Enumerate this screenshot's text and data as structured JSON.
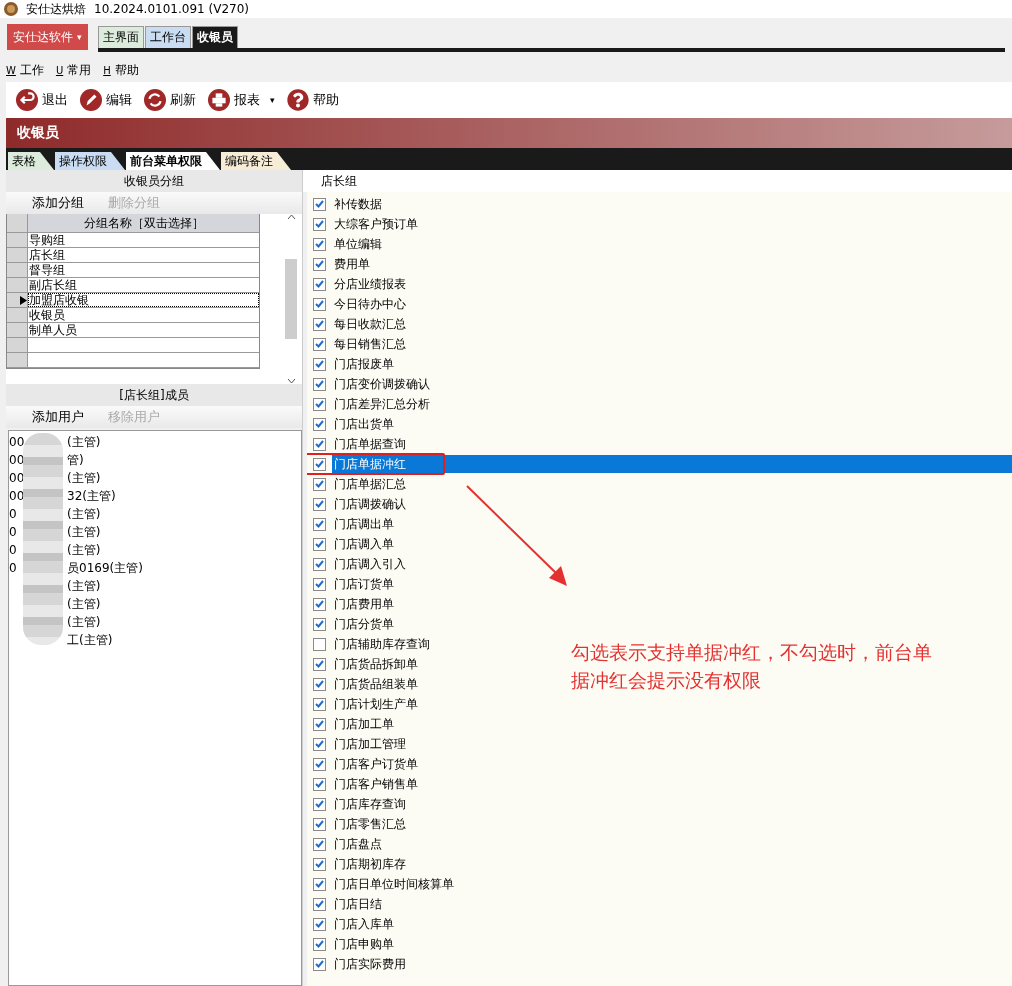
{
  "window": {
    "title": "安仕达烘焙",
    "version": "10.2024.0101.091 (V270)"
  },
  "brand_menu": {
    "label": "安仕达软件",
    "caret": "▾"
  },
  "app_tabs": [
    {
      "label": "主界面",
      "selected": false
    },
    {
      "label": "工作台",
      "selected": false
    },
    {
      "label": "收银员",
      "selected": true
    }
  ],
  "menu": [
    {
      "key": "W",
      "label": "工作"
    },
    {
      "key": "U",
      "label": "常用"
    },
    {
      "key": "H",
      "label": "帮助"
    }
  ],
  "toolbar": [
    {
      "kind": "exit",
      "label": "退出"
    },
    {
      "kind": "edit",
      "label": "编辑"
    },
    {
      "kind": "refresh",
      "label": "刷新"
    },
    {
      "kind": "print",
      "label": "报表",
      "caret": "▾"
    },
    {
      "kind": "help",
      "label": "帮助"
    }
  ],
  "page_title": "收银员",
  "page_tabs": [
    {
      "label": "表格",
      "selected": false,
      "color": "#dcebdc"
    },
    {
      "label": "操作权限",
      "selected": false,
      "color": "#c9dcf2"
    },
    {
      "label": "前台菜单权限",
      "selected": true,
      "color": "#ffffff"
    },
    {
      "label": "编码备注",
      "selected": false,
      "color": "#f7ecd6"
    }
  ],
  "groups_panel": {
    "title": "收银员分组",
    "actions": [
      {
        "label": "添加分组",
        "disabled": false
      },
      {
        "label": "删除分组",
        "disabled": true
      }
    ],
    "column": "分组名称［双击选择］",
    "rows": [
      {
        "name": "导购组",
        "selected": false
      },
      {
        "name": "店长组",
        "selected": false
      },
      {
        "name": "督导组",
        "selected": false
      },
      {
        "name": "副店长组",
        "selected": false
      },
      {
        "name": "加盟店收银",
        "selected": true
      },
      {
        "name": "收银员",
        "selected": false
      },
      {
        "name": "制单人员",
        "selected": false
      }
    ]
  },
  "members_panel": {
    "title": "[店长组]成员",
    "actions": [
      {
        "label": "添加用户",
        "disabled": false
      },
      {
        "label": "移除用户",
        "disabled": true
      }
    ],
    "members": [
      {
        "prefix": "00",
        "suffix": "(主管)"
      },
      {
        "prefix": "00",
        "suffix": "管)"
      },
      {
        "prefix": "00",
        "suffix": "(主管)"
      },
      {
        "prefix": "00",
        "suffix": "32(主管)"
      },
      {
        "prefix": "0",
        "suffix": "(主管)"
      },
      {
        "prefix": "0",
        "suffix": "(主管)"
      },
      {
        "prefix": "0",
        "suffix": "(主管)"
      },
      {
        "prefix": "0",
        "suffix": "员0169(主管)"
      },
      {
        "suffix": "(主管)"
      },
      {
        "suffix": "(主管)"
      },
      {
        "suffix": "(主管)"
      },
      {
        "suffix": "工(主管)"
      }
    ]
  },
  "permissions": {
    "group": "店长组",
    "items": [
      {
        "label": "补传数据",
        "checked": true,
        "selected": false
      },
      {
        "label": "大综客户预订单",
        "checked": true,
        "selected": false
      },
      {
        "label": "单位编辑",
        "checked": true,
        "selected": false
      },
      {
        "label": "费用单",
        "checked": true,
        "selected": false
      },
      {
        "label": "分店业绩报表",
        "checked": true,
        "selected": false
      },
      {
        "label": "今日待办中心",
        "checked": true,
        "selected": false
      },
      {
        "label": "每日收款汇总",
        "checked": true,
        "selected": false
      },
      {
        "label": "每日销售汇总",
        "checked": true,
        "selected": false
      },
      {
        "label": "门店报废单",
        "checked": true,
        "selected": false
      },
      {
        "label": "门店变价调拨确认",
        "checked": true,
        "selected": false
      },
      {
        "label": "门店差异汇总分析",
        "checked": true,
        "selected": false
      },
      {
        "label": "门店出货单",
        "checked": true,
        "selected": false
      },
      {
        "label": "门店单据查询",
        "checked": true,
        "selected": false
      },
      {
        "label": "门店单据冲红",
        "checked": true,
        "selected": true
      },
      {
        "label": "门店单据汇总",
        "checked": true,
        "selected": false
      },
      {
        "label": "门店调拨确认",
        "checked": true,
        "selected": false
      },
      {
        "label": "门店调出单",
        "checked": true,
        "selected": false
      },
      {
        "label": "门店调入单",
        "checked": true,
        "selected": false
      },
      {
        "label": "门店调入引入",
        "checked": true,
        "selected": false
      },
      {
        "label": "门店订货单",
        "checked": true,
        "selected": false
      },
      {
        "label": "门店费用单",
        "checked": true,
        "selected": false
      },
      {
        "label": "门店分货单",
        "checked": true,
        "selected": false
      },
      {
        "label": "门店辅助库存查询",
        "checked": false,
        "selected": false
      },
      {
        "label": "门店货品拆卸单",
        "checked": true,
        "selected": false
      },
      {
        "label": "门店货品组装单",
        "checked": true,
        "selected": false
      },
      {
        "label": "门店计划生产单",
        "checked": true,
        "selected": false
      },
      {
        "label": "门店加工单",
        "checked": true,
        "selected": false
      },
      {
        "label": "门店加工管理",
        "checked": true,
        "selected": false
      },
      {
        "label": "门店客户订货单",
        "checked": true,
        "selected": false
      },
      {
        "label": "门店客户销售单",
        "checked": true,
        "selected": false
      },
      {
        "label": "门店库存查询",
        "checked": true,
        "selected": false
      },
      {
        "label": "门店零售汇总",
        "checked": true,
        "selected": false
      },
      {
        "label": "门店盘点",
        "checked": true,
        "selected": false
      },
      {
        "label": "门店期初库存",
        "checked": true,
        "selected": false
      },
      {
        "label": "门店日单位时间核算单",
        "checked": true,
        "selected": false
      },
      {
        "label": "门店日结",
        "checked": true,
        "selected": false
      },
      {
        "label": "门店入库单",
        "checked": true,
        "selected": false
      },
      {
        "label": "门店申购单",
        "checked": true,
        "selected": false
      },
      {
        "label": "门店实际费用",
        "checked": true,
        "selected": false
      }
    ]
  },
  "annotation": {
    "text": "勾选表示支持单据冲红，不勾选时，前台单据冲红会提示没有权限"
  }
}
